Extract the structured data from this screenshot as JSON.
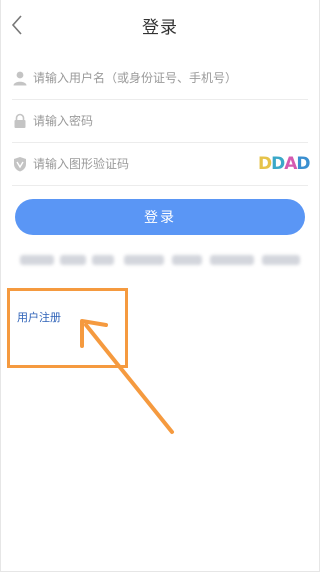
{
  "header": {
    "title": "登录",
    "back_icon": "chevron-left-icon"
  },
  "form": {
    "username": {
      "placeholder": "请输入用户名（或身份证号、手机号）",
      "icon": "user-icon"
    },
    "password": {
      "placeholder": "请输入密码",
      "icon": "lock-icon"
    },
    "captcha": {
      "placeholder": "请输入图形验证码",
      "icon": "shield-v-icon",
      "image_text": [
        "D",
        "D",
        "A",
        "D"
      ],
      "image_colors": [
        "#e6c34a",
        "#3aa8c8",
        "#d45ab0",
        "#3a8fd0"
      ]
    },
    "login_label": "登录"
  },
  "register": {
    "label": "用户注册"
  },
  "colors": {
    "primary": "#5a96f5",
    "link": "#2e62b8",
    "annotation": "#f59a3f"
  }
}
